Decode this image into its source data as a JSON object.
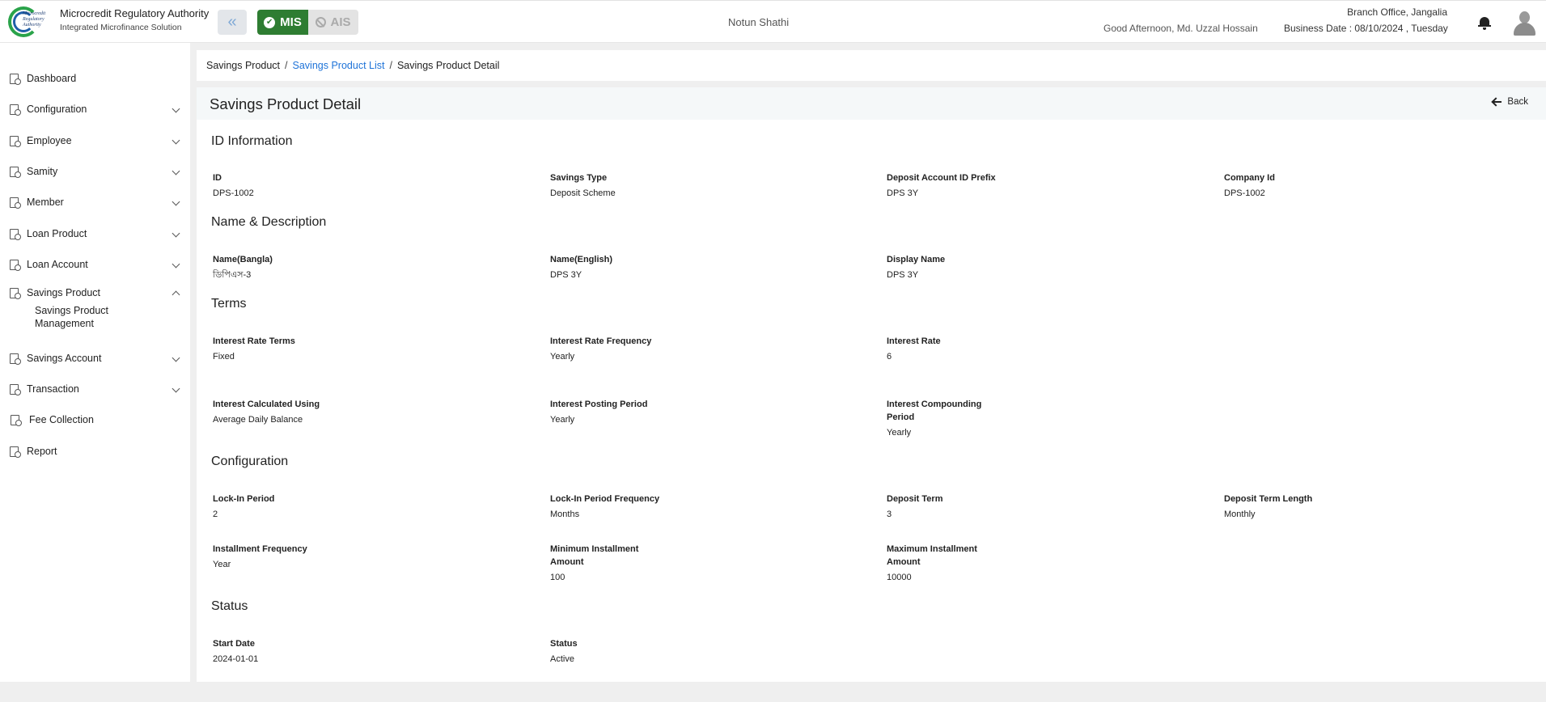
{
  "header": {
    "brand_title": "Microcredit Regulatory Authority",
    "brand_subtitle": "Integrated Microfinance Solution",
    "logo_text": "Microcredit Regulatory Authority",
    "mis_label": "MIS",
    "ais_label": "AIS",
    "org_name": "Notun Shathi",
    "greeting": "Good Afternoon, Md. Uzzal Hossain",
    "branch": "Branch Office, Jangalia",
    "business_date": "Business Date : 08/10/2024 , Tuesday"
  },
  "sidebar": {
    "items": [
      {
        "label": "Dashboard"
      },
      {
        "label": "Configuration"
      },
      {
        "label": "Employee"
      },
      {
        "label": "Samity"
      },
      {
        "label": "Member"
      },
      {
        "label": "Loan Product"
      },
      {
        "label": "Loan Account"
      },
      {
        "label": "Savings Product"
      },
      {
        "label": "Savings Account"
      },
      {
        "label": "Transaction"
      },
      {
        "label": "Fee Collection"
      },
      {
        "label": "Report"
      }
    ],
    "sub_item": "Savings Product Management"
  },
  "breadcrumb": {
    "items": [
      "Savings Product",
      "Savings Product List",
      "Savings Product Detail"
    ]
  },
  "page": {
    "title": "Savings Product Detail",
    "back_label": "Back"
  },
  "sections": {
    "id_info": {
      "title": "ID Information",
      "fields": [
        {
          "label": "ID",
          "value": "DPS-1002"
        },
        {
          "label": "Savings Type",
          "value": "Deposit Scheme"
        },
        {
          "label": "Deposit Account ID Prefix",
          "value": "DPS 3Y"
        },
        {
          "label": "Company Id",
          "value": "DPS-1002"
        }
      ]
    },
    "name_desc": {
      "title": "Name & Description",
      "fields": [
        {
          "label": "Name(Bangla)",
          "value": "ডিপিএস-3"
        },
        {
          "label": "Name(English)",
          "value": "DPS 3Y"
        },
        {
          "label": "Display Name",
          "value": "DPS 3Y"
        }
      ]
    },
    "terms": {
      "title": "Terms",
      "fields": [
        {
          "label": "Interest Rate Terms",
          "value": "Fixed"
        },
        {
          "label": "Interest Rate Frequency",
          "value": "Yearly"
        },
        {
          "label": "Interest Rate",
          "value": "6"
        },
        {
          "label": "Interest Calculated Using",
          "value": "Average Daily Balance"
        },
        {
          "label": "Interest Posting Period",
          "value": "Yearly"
        },
        {
          "label": "Interest Compounding Period",
          "value": "Yearly"
        }
      ]
    },
    "configuration": {
      "title": "Configuration",
      "fields": [
        {
          "label": "Lock-In Period",
          "value": "2"
        },
        {
          "label": "Lock-In Period Frequency",
          "value": "Months"
        },
        {
          "label": "Deposit Term",
          "value": "3"
        },
        {
          "label": "Deposit Term Length",
          "value": "Monthly"
        },
        {
          "label": "Installment Frequency",
          "value": "Year"
        },
        {
          "label": "Minimum Installment Amount",
          "value": "100"
        },
        {
          "label": "Maximum Installment Amount",
          "value": "10000"
        }
      ]
    },
    "status": {
      "title": "Status",
      "fields": [
        {
          "label": "Start Date",
          "value": "2024-01-01"
        },
        {
          "label": "Status",
          "value": "Active"
        }
      ]
    }
  },
  "colors": {
    "mis_green": "#2e7d32",
    "link_blue": "#1e73d8",
    "title_bar_bg": "#f5f8f9"
  }
}
